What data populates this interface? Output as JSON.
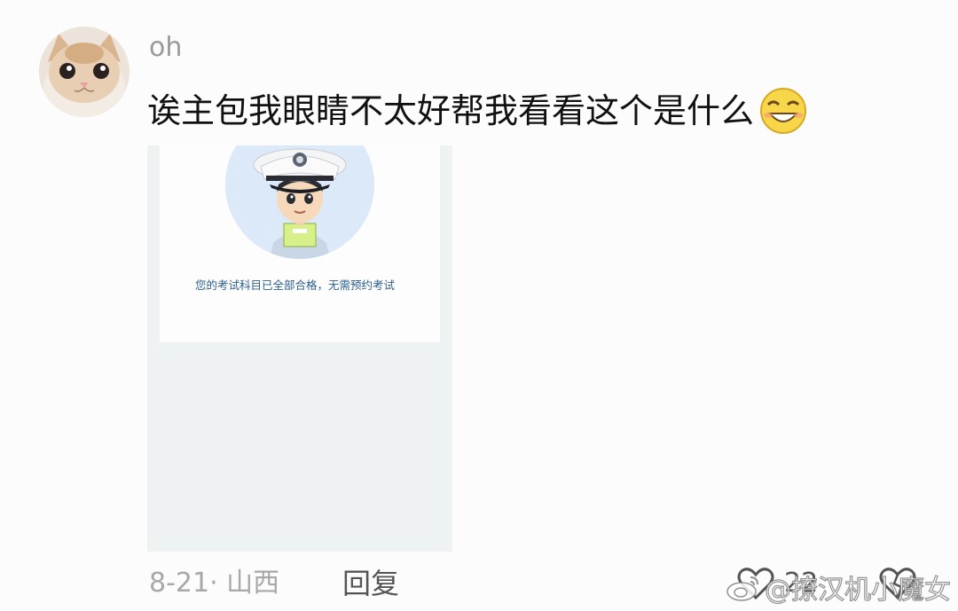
{
  "comment": {
    "username": "oh",
    "text": "诶主包我眼睛不太好帮我看看这个是什么",
    "emoji_icon": "grinning-squint-emoji-icon",
    "attachment": {
      "message": "您的考试科目已全部合格，无需预约考试",
      "illustration_icon": "police-officer-icon"
    },
    "footer": {
      "date_location": "8-21· 山西",
      "reply_label": "回复",
      "like_count": "22"
    }
  },
  "watermark": {
    "text": "@撩汉机小魔女"
  },
  "colors": {
    "background": "#fbfcfb",
    "username": "#9a9a9a",
    "comment_text": "#111111",
    "meta_text": "#a8a8a8",
    "shot_text": "#2f5f8f"
  }
}
